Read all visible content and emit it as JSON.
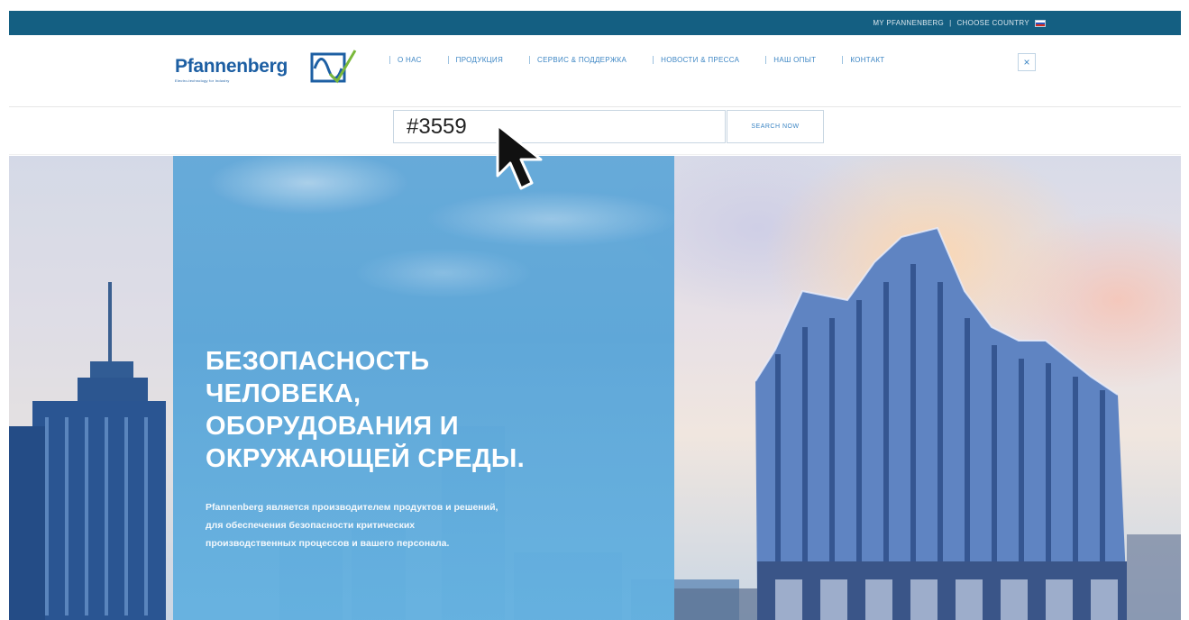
{
  "topbar": {
    "my_account": "MY PFANNENBERG",
    "separator": "|",
    "choose_country": "CHOOSE COUNTRY"
  },
  "logo": {
    "wordmark": "Pfannenberg",
    "tagline": "Electro-technology for Industry"
  },
  "nav": {
    "items": [
      "О НАС",
      "ПРОДУКЦИЯ",
      "СЕРВИС & ПОДДЕРЖКА",
      "НОВОСТИ & ПРЕССА",
      "НАШ ОПЫТ",
      "КОНТАКТ"
    ],
    "close_label": "×"
  },
  "search": {
    "value": "#3559",
    "button_label": "SEARCH NOW"
  },
  "hero": {
    "headline_lines": [
      "БЕЗОПАСНОСТЬ",
      "ЧЕЛОВЕКА,",
      "ОБОРУДОВАНИЯ И",
      "ОКРУЖАЮЩЕЙ СРЕДЫ."
    ],
    "subtext_lines": [
      "Pfannenberg является производителем продуктов и решений,",
      "для обеспечения безопасности критических",
      "производственных процессов и вашего персонала."
    ]
  },
  "colors": {
    "topbar": "#145f82",
    "brand_blue": "#1d5fa3",
    "nav_blue": "#3d86c4",
    "panel_blue": "#5aa5d8",
    "logo_green": "#7ab83a"
  },
  "icons": {
    "close": "close-icon",
    "flag": "russia-flag-icon",
    "cursor": "mouse-pointer-icon",
    "logo_mark": "sine-wave-check-icon"
  }
}
